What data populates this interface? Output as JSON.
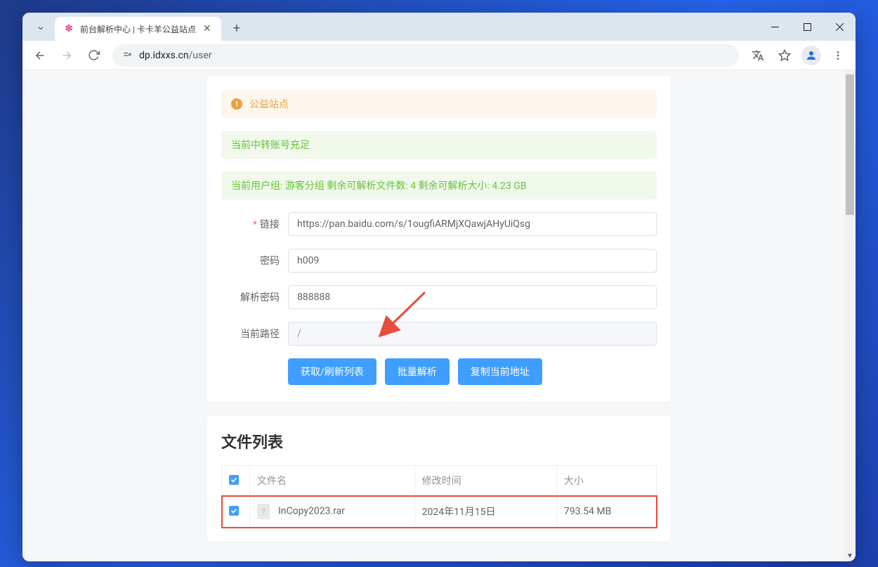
{
  "browser": {
    "tab_title": "前台解析中心 | 卡卡羊公益站点",
    "url_domain": "dp.idxxs.cn",
    "url_path": "/user"
  },
  "alerts": {
    "warning_text": "公益站点",
    "success_text": "当前中转账号充足",
    "info_text": "当前用户组: 游客分组   剩余可解析文件数: 4   剩余可解析大小: 4.23 GB"
  },
  "form": {
    "link_label": "链接",
    "link_value": "https://pan.baidu.com/s/1ougfiARMjXQawjAHyUiQsg",
    "password_label": "密码",
    "password_value": "h009",
    "parse_password_label": "解析密码",
    "parse_password_value": "888888",
    "current_path_label": "当前路径",
    "current_path_value": "/"
  },
  "buttons": {
    "refresh": "获取/刷新列表",
    "batch_parse": "批量解析",
    "copy_address": "复制当前地址"
  },
  "file_list": {
    "title": "文件列表",
    "headers": {
      "filename": "文件名",
      "modified": "修改时间",
      "size": "大小"
    },
    "rows": [
      {
        "filename": "InCopy2023.rar",
        "modified": "2024年11月15日",
        "size": "793.54 MB"
      }
    ]
  }
}
